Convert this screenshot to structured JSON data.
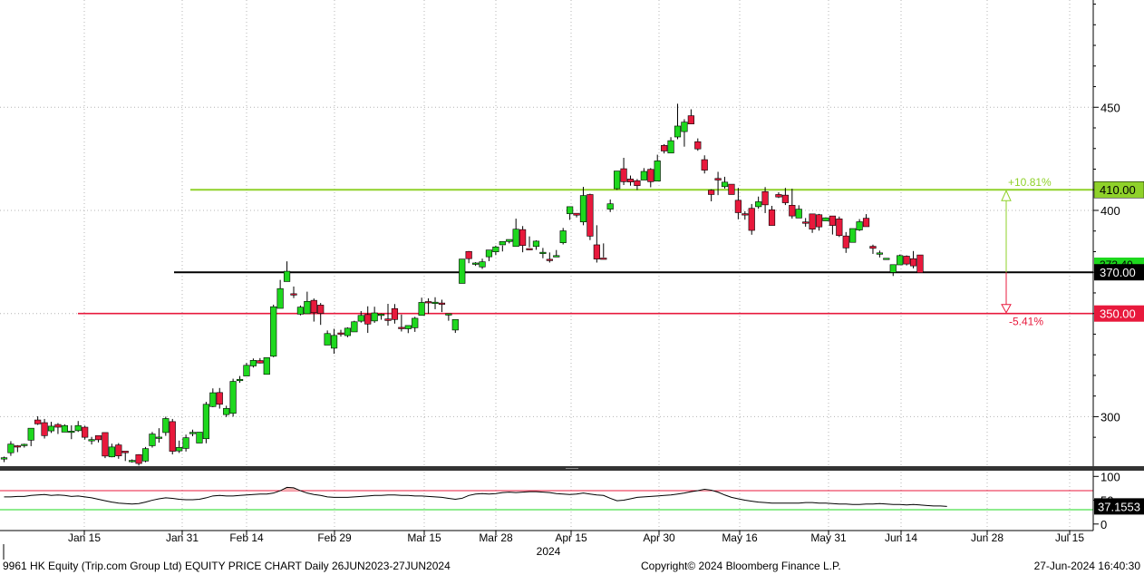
{
  "footer": {
    "left": "9961 HK Equity (Trip.com Group Ltd) EQUITY PRICE CHART  Daily 26JUN2023-27JUN2024",
    "center": "Copyright© 2024 Bloomberg Finance L.P.",
    "right": "27-Jun-2024 16:40:30"
  },
  "colors": {
    "up": "#1ed81e",
    "down": "#e8193c",
    "green_line": "#8fd12a",
    "red_line": "#e8193c",
    "black_line": "#000000"
  },
  "chart_data": [
    {
      "type": "candlestick",
      "x_ticks": [
        "Jan 15",
        "Jan 31",
        "Feb 14",
        "Feb 29",
        "Mar 15",
        "Mar 28",
        "Apr 15",
        "Apr 30",
        "May 16",
        "May 31",
        "Jun 14",
        "Jun 28",
        "Jul 15"
      ],
      "year_label": "2024",
      "y_ticks": [
        300,
        350,
        400,
        450
      ],
      "ylim": [
        276,
        502
      ],
      "current_price_label": "373.40",
      "hlines": [
        {
          "value": 410,
          "label": "410.00",
          "pct": "+10.81%",
          "color": "green"
        },
        {
          "value": 370,
          "label": "370.00",
          "color": "black"
        },
        {
          "value": 350,
          "label": "350.00",
          "pct": "-5.41%",
          "color": "red"
        }
      ],
      "candles": [
        [
          279.5,
          280.1,
          278.0,
          280.6
        ],
        [
          282.5,
          286.7,
          281.0,
          288.1
        ],
        [
          285.9,
          285.4,
          282.8,
          286.2
        ],
        [
          286.5,
          286.6,
          285.0,
          286.9
        ],
        [
          288.6,
          294.4,
          285.7,
          293.3
        ],
        [
          298.4,
          296.5,
          296.0,
          300.2
        ],
        [
          297.1,
          290.8,
          289.4,
          298.9
        ],
        [
          293.1,
          295.4,
          292.1,
          297.5
        ],
        [
          296.2,
          294.9,
          291.6,
          296.9
        ],
        [
          292.5,
          295.7,
          294.4,
          296.3
        ],
        [
          293.0,
          293.0,
          289.1,
          295.8
        ],
        [
          293.2,
          295.7,
          292.6,
          297.9
        ],
        [
          294.9,
          290.0,
          288.9,
          295.6
        ],
        [
          288.8,
          288.9,
          286.5,
          290.2
        ],
        [
          290.8,
          288.8,
          287.5,
          289.6
        ],
        [
          292.3,
          280.9,
          279.9,
          292.3
        ],
        [
          280.5,
          285.3,
          280.3,
          286.9
        ],
        [
          286.3,
          281.0,
          279.6,
          287.2
        ],
        [
          283.3,
          282.5,
          278.5,
          282.5
        ],
        [
          278.2,
          278.8,
          277.7,
          279.3
        ],
        [
          281.6,
          277.3,
          276.3,
          281.8
        ],
        [
          278.5,
          284.5,
          277.9,
          285.3
        ],
        [
          285.9,
          291.6,
          285.0,
          292.6
        ],
        [
          290.0,
          290.1,
          287.4,
          294.4
        ],
        [
          292.3,
          299.1,
          290.7,
          300.0
        ],
        [
          297.6,
          283.2,
          281.7,
          298.9
        ],
        [
          283.4,
          285.1,
          282.4,
          288.4
        ],
        [
          284.6,
          289.8,
          283.1,
          291.3
        ],
        [
          291.8,
          292.4,
          290.5,
          293.7
        ],
        [
          287.2,
          292.5,
          288.5,
          292.5
        ],
        [
          289.3,
          306.0,
          287.1,
          307.2
        ],
        [
          304.9,
          311.6,
          304.6,
          313.7
        ],
        [
          311.7,
          306.0,
          303.9,
          313.9
        ],
        [
          301.0,
          304.0,
          299.8,
          305.3
        ],
        [
          301.6,
          317.1,
          300.0,
          318.4
        ],
        [
          317.7,
          318.1,
          316.4,
          319.7
        ],
        [
          319.7,
          324.9,
          319.8,
          326.1
        ],
        [
          324.6,
          327.3,
          323.8,
          328.2
        ],
        [
          327.2,
          326.0,
          325.8,
          328.4
        ],
        [
          320.5,
          328.6,
          321.8,
          328.6
        ],
        [
          329.3,
          353.3,
          328.8,
          354.3
        ],
        [
          352.5,
          362.1,
          352.7,
          366.3
        ],
        [
          365.5,
          370.5,
          367.2,
          375.3
        ],
        [
          359.6,
          359.2,
          357.5,
          363.1
        ],
        [
          349.7,
          353.1,
          349.1,
          353.9
        ],
        [
          349.9,
          355.9,
          350.9,
          360.6
        ],
        [
          356.4,
          350.4,
          346.1,
          357.3
        ],
        [
          354.1,
          350.0,
          344.5,
          355.1
        ],
        [
          334.7,
          340.3,
          335.9,
          341.8
        ],
        [
          333.2,
          339.4,
          330.5,
          342.6
        ],
        [
          340.6,
          340.1,
          338.8,
          342.1
        ],
        [
          339.3,
          342.9,
          338.5,
          343.3
        ],
        [
          341.1,
          346.0,
          342.0,
          346.5
        ],
        [
          346.3,
          349.1,
          345.6,
          351.2
        ],
        [
          349.5,
          344.9,
          340.6,
          353.5
        ],
        [
          346.4,
          350.3,
          345.5,
          353.3
        ],
        [
          349.7,
          349.7,
          347.0,
          350.0
        ],
        [
          347.4,
          346.6,
          344.1,
          354.7
        ],
        [
          352.4,
          347.1,
          345.1,
          354.6
        ],
        [
          343.3,
          343.0,
          341.3,
          349.5
        ],
        [
          342.6,
          344.2,
          340.5,
          343.7
        ],
        [
          343.1,
          347.7,
          341.1,
          348.4
        ],
        [
          349.1,
          355.4,
          350.0,
          357.7
        ],
        [
          355.8,
          355.6,
          349.9,
          357.4
        ],
        [
          355.1,
          355.5,
          352.1,
          357.9
        ],
        [
          355.1,
          354.5,
          350.7,
          356.7
        ],
        [
          349.7,
          349.9,
          346.5,
          349.9
        ],
        [
          342.0,
          347.1,
          340.6,
          347.2
        ],
        [
          364.6,
          376.4,
          364.6,
          376.4
        ],
        [
          380.1,
          376.6,
          374.4,
          380.3
        ],
        [
          374.4,
          374.5,
          373.1,
          374.9
        ],
        [
          372.6,
          375.1,
          371.6,
          376.6
        ],
        [
          377.5,
          380.8,
          375.4,
          380.6
        ],
        [
          379.9,
          382.3,
          378.3,
          382.9
        ],
        [
          383.3,
          384.9,
          380.1,
          383.0
        ],
        [
          384.9,
          385.9,
          384.0,
          385.9
        ],
        [
          382.5,
          390.9,
          382.8,
          396.0
        ],
        [
          390.7,
          383.0,
          379.7,
          392.4
        ],
        [
          381.5,
          381.0,
          382.1,
          387.4
        ],
        [
          382.5,
          385.1,
          380.9,
          385.5
        ],
        [
          379.7,
          379.7,
          376.8,
          381.8
        ],
        [
          376.3,
          376.2,
          374.7,
          379.6
        ],
        [
          377.4,
          378.1,
          377.6,
          380.8
        ],
        [
          384.3,
          390.1,
          383.5,
          391.5
        ],
        [
          398.4,
          401.8,
          395.4,
          401.8
        ],
        [
          398.6,
          397.7,
          396.6,
          398.3
        ],
        [
          394.4,
          407.2,
          392.8,
          411.4
        ],
        [
          407.7,
          387.5,
          385.6,
          408.1
        ],
        [
          383.3,
          376.4,
          374.7,
          392.8
        ],
        [
          376.9,
          376.4,
          377.2,
          384.0
        ],
        [
          400.6,
          403.2,
          399.2,
          405.3
        ],
        [
          410.5,
          419.1,
          410.0,
          418.1
        ],
        [
          420.2,
          413.9,
          412.3,
          425.5
        ],
        [
          415.2,
          413.8,
          412.0,
          416.9
        ],
        [
          414.4,
          412.0,
          409.9,
          415.2
        ],
        [
          414.7,
          418.9,
          416.0,
          420.5
        ],
        [
          419.9,
          413.9,
          411.2,
          420.5
        ],
        [
          414.2,
          424.0,
          414.5,
          427.0
        ],
        [
          431.5,
          428.8,
          427.6,
          432.1
        ],
        [
          427.8,
          433.8,
          431.9,
          435.5
        ],
        [
          435.6,
          440.9,
          434.5,
          451.7
        ],
        [
          438.2,
          442.8,
          430.9,
          444.2
        ],
        [
          445.9,
          441.9,
          442.4,
          449.0
        ],
        [
          433.3,
          429.8,
          428.9,
          434.9
        ],
        [
          424.6,
          419.5,
          417.9,
          426.7
        ],
        [
          409.8,
          407.7,
          404.4,
          410.2
        ],
        [
          415.5,
          414.7,
          407.4,
          418.7
        ],
        [
          411.5,
          413.7,
          410.6,
          416.3
        ],
        [
          412.7,
          407.7,
          409.4,
          411.5
        ],
        [
          404.9,
          398.9,
          395.7,
          410.9
        ],
        [
          398.4,
          397.8,
          395.5,
          399.6
        ],
        [
          401.0,
          390.3,
          388.2,
          403.1
        ],
        [
          401.8,
          404.2,
          400.8,
          406.7
        ],
        [
          409.1,
          402.7,
          398.7,
          411.3
        ],
        [
          400.3,
          392.7,
          393.1,
          402.2
        ],
        [
          407.7,
          406.5,
          406.0,
          408.8
        ],
        [
          407.4,
          403.7,
          402.6,
          410.9
        ],
        [
          402.5,
          397.3,
          396.0,
          410.5
        ],
        [
          396.3,
          400.6,
          396.4,
          402.5
        ],
        [
          394.4,
          394.3,
          392.1,
          396.3
        ],
        [
          398.3,
          390.9,
          389.1,
          397.1
        ],
        [
          397.9,
          392.0,
          390.2,
          398.3
        ],
        [
          394.9,
          396.4,
          395.9,
          396.6
        ],
        [
          397.3,
          392.7,
          388.3,
          397.3
        ],
        [
          395.9,
          387.8,
          387.1,
          397.0
        ],
        [
          387.6,
          381.8,
          379.4,
          389.5
        ],
        [
          384.5,
          391.2,
          387.8,
          390.8
        ],
        [
          390.5,
          394.5,
          390.0,
          395.8
        ],
        [
          396.2,
          392.1,
          393.1,
          398.2
        ],
        [
          382.6,
          381.6,
          378.9,
          383.4
        ],
        [
          379.2,
          379.4,
          377.2,
          380.5
        ],
        [
          376.8,
          376.8,
          376.8,
          376.8
        ],
        [
          369.9,
          373.7,
          368.2,
          373.6
        ],
        [
          373.6,
          378.1,
          373.8,
          378.6
        ],
        [
          377.8,
          374.0,
          373.3,
          378.2
        ],
        [
          376.6,
          373.1,
          371.9,
          380.3
        ],
        [
          378.4,
          369.8,
          369.9,
          378.4
        ]
      ]
    },
    {
      "type": "line",
      "name": "",
      "y_ticks": [
        0,
        50,
        100
      ],
      "ylim": [
        -8,
        112
      ],
      "thresholds": [
        70,
        30
      ],
      "last_label": "37.1553",
      "values": [
        57,
        57,
        58,
        58,
        60,
        61,
        62,
        60,
        61,
        60,
        58,
        59,
        57,
        55,
        52,
        49,
        46,
        44,
        43,
        42,
        43,
        46,
        50,
        53,
        55,
        54,
        52,
        51,
        51,
        52,
        55,
        59,
        60,
        59,
        59,
        60,
        61,
        62,
        63,
        63,
        65,
        70,
        77,
        76,
        70,
        65,
        62,
        60,
        57,
        56,
        56,
        56,
        57,
        58,
        59,
        60,
        60,
        61,
        61,
        60,
        60,
        59,
        59,
        58,
        57,
        56,
        54,
        52,
        54,
        60,
        63,
        64,
        63,
        64,
        66,
        67,
        66,
        67,
        68,
        68,
        67,
        66,
        64,
        63,
        62,
        63,
        65,
        63,
        61,
        60,
        54,
        49,
        50,
        53,
        56,
        57,
        58,
        59,
        60,
        61,
        63,
        65,
        68,
        70,
        73,
        71,
        67,
        61,
        56,
        53,
        50,
        48,
        46,
        45,
        44,
        44,
        44,
        44,
        44,
        45,
        45,
        44,
        44,
        43,
        42,
        42,
        41,
        41,
        42,
        42,
        43,
        42,
        41,
        41,
        40,
        41,
        40,
        39,
        38,
        38,
        37
      ]
    }
  ]
}
